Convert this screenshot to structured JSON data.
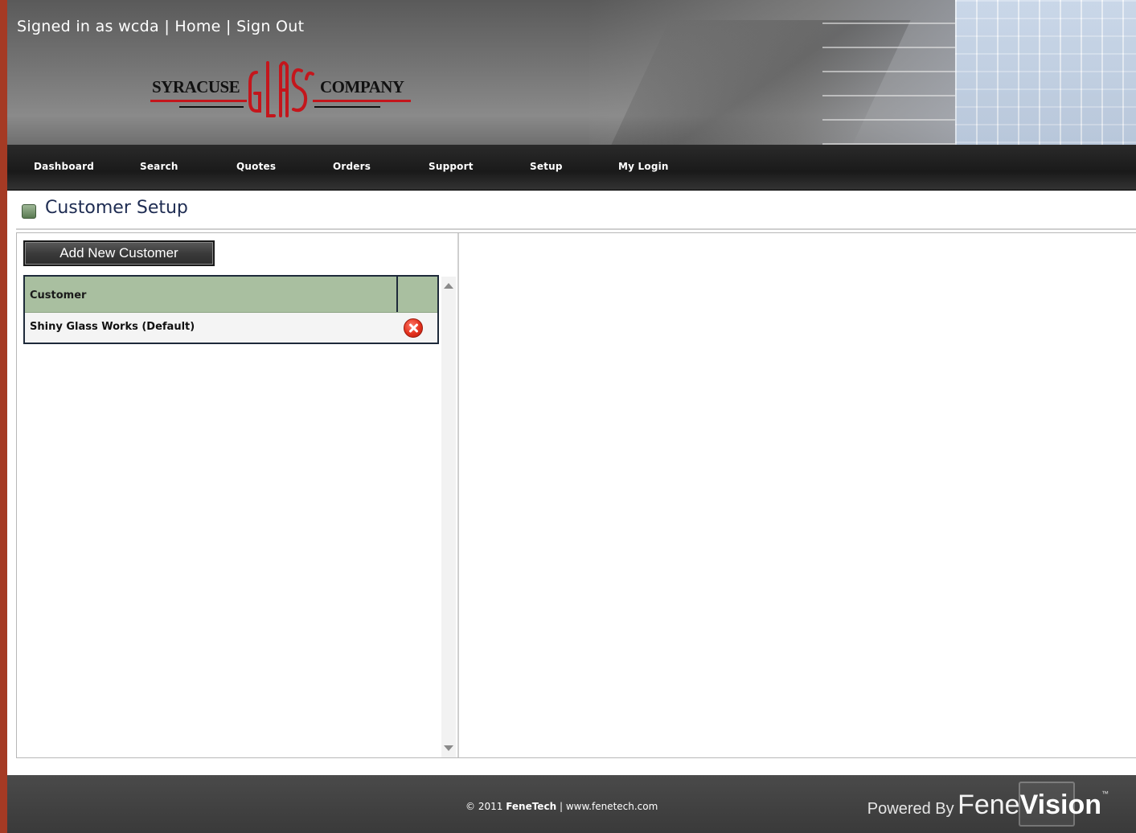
{
  "header": {
    "signed_in_text": "Signed in as wcda",
    "separator": "|",
    "home_link": "Home",
    "signout_link": "Sign Out",
    "logo": {
      "left_word": "SYRACUSE",
      "center_word": "GLASS",
      "right_word": "COMPANY",
      "colors": {
        "accent": "#c4161c",
        "text": "#111111"
      }
    }
  },
  "nav": {
    "items": [
      {
        "label": "Dashboard"
      },
      {
        "label": "Search"
      },
      {
        "label": "Quotes"
      },
      {
        "label": "Orders"
      },
      {
        "label": "Support"
      },
      {
        "label": "Setup"
      },
      {
        "label": "My Login"
      }
    ]
  },
  "page": {
    "title": "Customer Setup",
    "title_icon": "green-square-icon"
  },
  "customers": {
    "add_button_label": "Add New Customer",
    "columns": [
      "Customer",
      ""
    ],
    "rows": [
      {
        "name": "Shiny Glass Works (Default)",
        "action_icon": "delete-icon"
      }
    ]
  },
  "footer": {
    "copyright_prefix": "© 2011",
    "company": "FeneTech",
    "separator": "|",
    "website": "www.fenetech.com",
    "powered_by": "Powered By",
    "brand_a": "Fene",
    "brand_b": "Vision",
    "brand_mark": "™"
  },
  "colors": {
    "grid_header": "#a9bfa0",
    "nav_bg": "#1a1a1a",
    "title_text": "#1e2c52",
    "delete_red": "#e3301c"
  }
}
